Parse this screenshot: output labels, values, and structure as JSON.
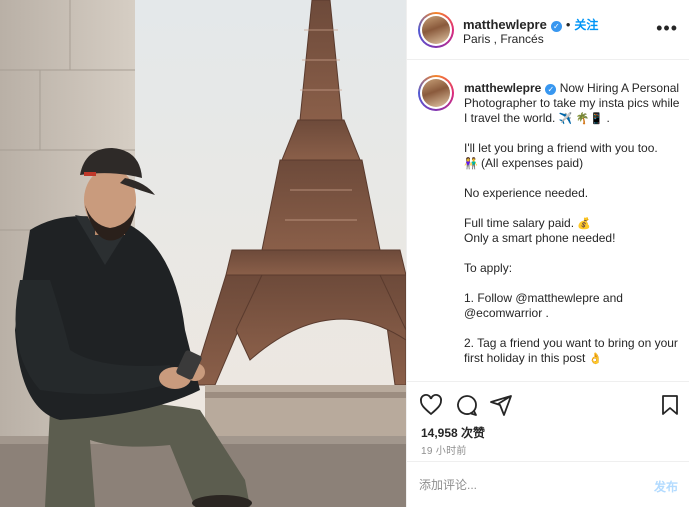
{
  "post": {
    "username": "matthewlepre",
    "follow_label": "关注",
    "location": "Paris , Francés",
    "more_label": "•••",
    "caption_lines": [
      "Now Hiring A Personal Photographer to take my insta pics while I travel the world.",
      "I'll let you bring a friend with you too.",
      "(All expenses paid)",
      "No experience needed.",
      "Full time salary paid.",
      "Only a smart phone needed!",
      "To apply:",
      "1. Follow @matthewlepre and @ecomwarrior .",
      "2. Tag a friend you want to bring on your first holiday in this post"
    ],
    "likes": "14,958 次赞",
    "time": "19 小时前"
  },
  "comment": {
    "placeholder": "添加评论...",
    "post_label": "发布"
  },
  "icons": {
    "heart": "heart-icon",
    "comment": "comment-icon",
    "share": "share-icon",
    "bookmark": "bookmark-icon",
    "verified": "verified-icon"
  },
  "colors": {
    "link_blue": "#0095f6",
    "verified_blue": "#3897f0",
    "post_disabled": "#b3dbff",
    "muted": "#8e8e8e"
  }
}
